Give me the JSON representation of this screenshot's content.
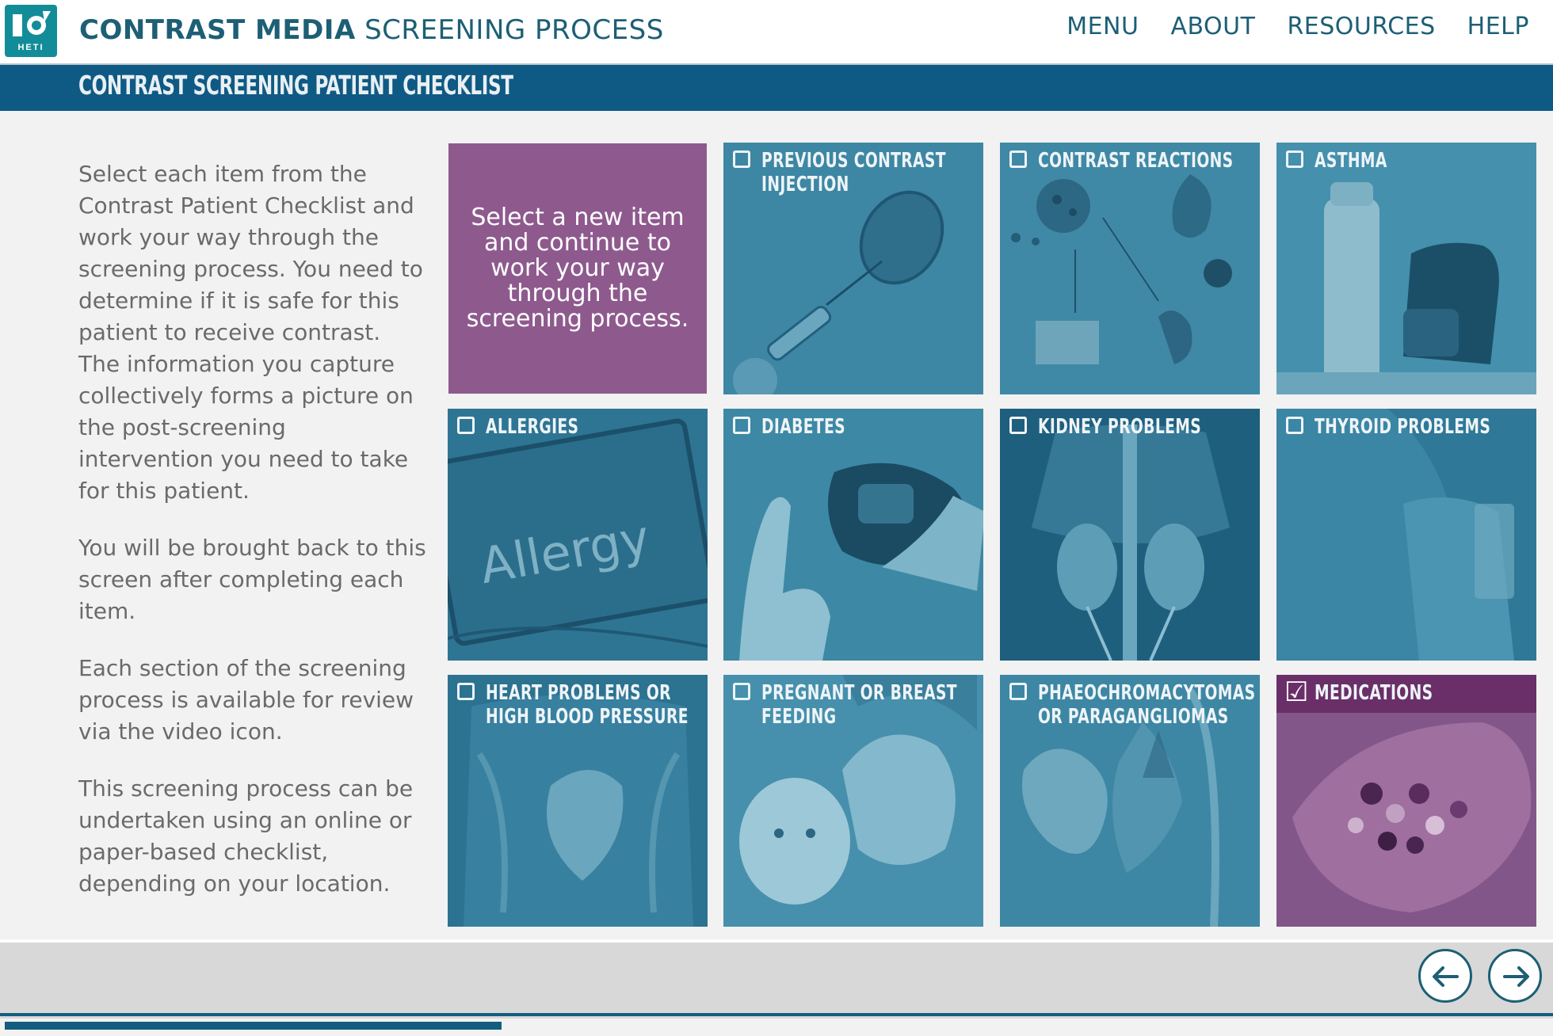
{
  "header": {
    "logo_text": "HETI",
    "title_strong": "CONTRAST MEDIA",
    "title_light": "SCREENING PROCESS",
    "nav": [
      "MENU",
      "ABOUT",
      "RESOURCES",
      "HELP"
    ]
  },
  "section": {
    "title": "CONTRAST SCREENING PATIENT CHECKLIST"
  },
  "instructions": [
    "Select each item from the Contrast Patient Checklist and work your way through the screening process. You need to determine if it is safe for this patient to receive contrast. The information you capture collectively forms a picture on the post-screening intervention you need to take for this patient.",
    "You will be brought back to this screen after completing each item.",
    "Each section of the screening process is available for review via the video icon.",
    "This screening process can be undertaken using an online or paper-based checklist, depending on your location."
  ],
  "prompt": "Select a new item and continue to work your way through the screening process.",
  "tiles": [
    {
      "label": "PREVIOUS CONTRAST INJECTION",
      "checked": false,
      "icon": "syringe"
    },
    {
      "label": "CONTRAST REACTIONS",
      "checked": false,
      "icon": "reaction-diagram"
    },
    {
      "label": "ASTHMA",
      "checked": false,
      "icon": "inhaler"
    },
    {
      "label": "ALLERGIES",
      "checked": false,
      "icon": "allergy-tablet",
      "image_text": "Allergy"
    },
    {
      "label": "DIABETES",
      "checked": false,
      "icon": "glucose-meter"
    },
    {
      "label": "KIDNEY PROBLEMS",
      "checked": false,
      "icon": "kidney-xray"
    },
    {
      "label": "THYROID PROBLEMS",
      "checked": false,
      "icon": "neck"
    },
    {
      "label": "HEART PROBLEMS OR HIGH BLOOD PRESSURE",
      "checked": false,
      "icon": "heart-xray"
    },
    {
      "label": "PREGNANT OR BREAST FEEDING",
      "checked": false,
      "icon": "mother-baby"
    },
    {
      "label": "PHAEOCHROMACYTOMAS OR PARAGANGLIOMAS",
      "checked": false,
      "icon": "adrenal"
    },
    {
      "label": "MEDICATIONS",
      "checked": true,
      "icon": "pills"
    }
  ],
  "footer": {
    "back_icon": "arrow-left-icon",
    "next_icon": "arrow-right-icon",
    "progress": 0.32
  },
  "colors": {
    "brand": "#1d5f75",
    "band": "#0e5a84",
    "tile": "#3a86a3",
    "selected": "#7b4d82",
    "prompt": "#8e5a8e"
  }
}
